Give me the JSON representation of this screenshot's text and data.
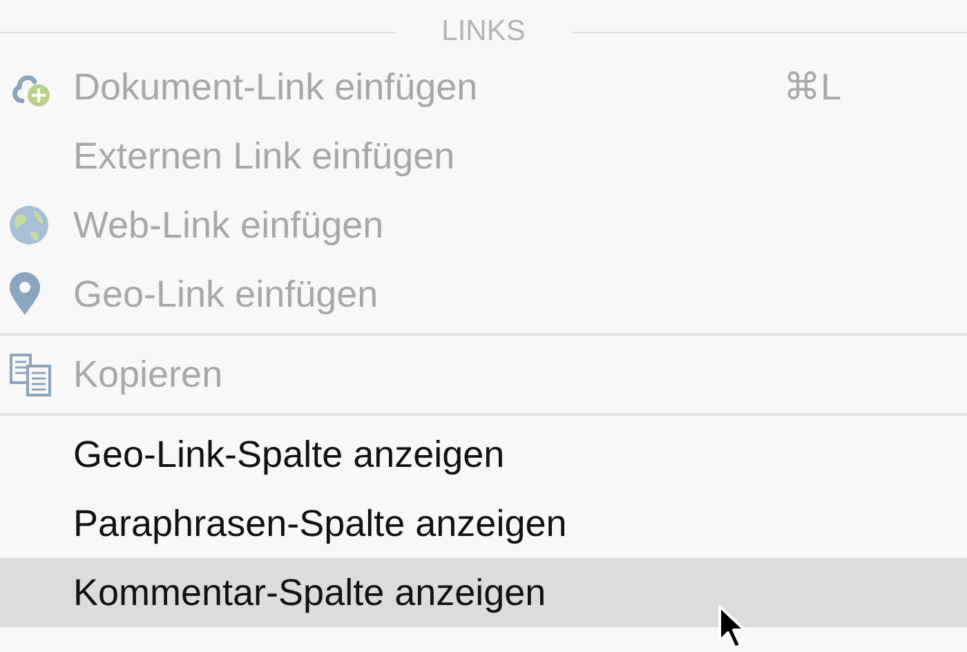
{
  "menu": {
    "header": "LINKS",
    "items": [
      {
        "kind": "cloud",
        "label": "Dokument-Link einfügen",
        "shortcut": "⌘L",
        "disabled": true,
        "selected": false
      },
      {
        "kind": "item",
        "label": "Externen Link einfügen",
        "disabled": true,
        "selected": false
      },
      {
        "kind": "globe",
        "label": "Web-Link einfügen",
        "disabled": true,
        "selected": false
      },
      {
        "kind": "pin",
        "label": "Geo-Link einfügen",
        "disabled": true,
        "selected": false
      },
      {
        "kind": "separator"
      },
      {
        "kind": "copy",
        "label": "Kopieren",
        "disabled": true,
        "selected": false
      },
      {
        "kind": "separator"
      },
      {
        "kind": "item",
        "label": "Geo-Link-Spalte anzeigen",
        "disabled": false,
        "selected": false
      },
      {
        "kind": "item",
        "label": "Paraphrasen-Spalte anzeigen",
        "disabled": false,
        "selected": false
      },
      {
        "kind": "item",
        "label": "Kommentar-Spalte anzeigen",
        "disabled": false,
        "selected": true
      }
    ]
  }
}
